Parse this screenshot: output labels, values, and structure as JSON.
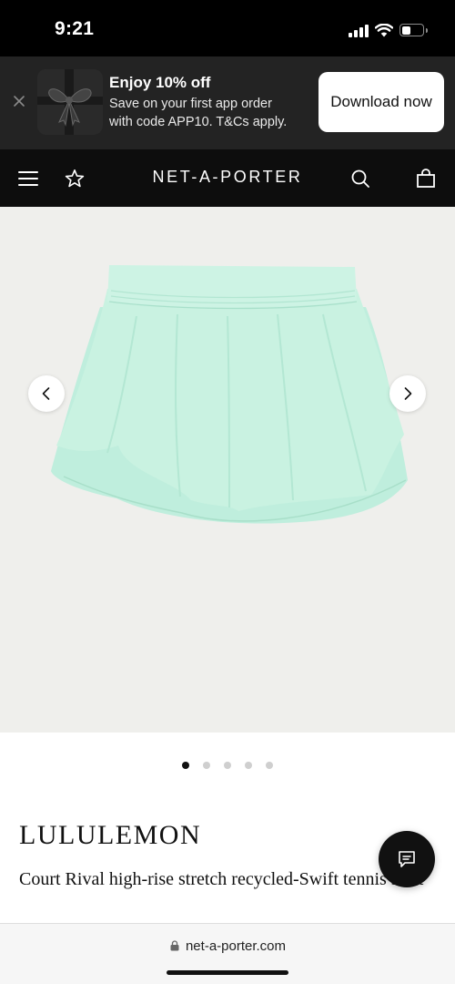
{
  "status_bar": {
    "time": "9:21",
    "icons": [
      "cellular-signal-icon",
      "wifi-icon",
      "battery-icon"
    ]
  },
  "promo_banner": {
    "title": "Enjoy 10% off",
    "line1": "Save on your first app order",
    "line2": "with code APP10. T&Cs apply.",
    "button_label": "Download now"
  },
  "navbar": {
    "brand": "NET-A-PORTER",
    "icons": [
      "menu-icon",
      "star-icon",
      "search-icon",
      "shopping-bag-icon"
    ]
  },
  "gallery": {
    "image_count": 5,
    "active_index": 0,
    "background_color": "#efefec",
    "product_color": "#c9f2e1"
  },
  "product": {
    "designer": "LULULEMON",
    "name": "Court Rival high-rise stretch recycled-Swift tennis skirt"
  },
  "browser": {
    "url": "net-a-porter.com"
  }
}
